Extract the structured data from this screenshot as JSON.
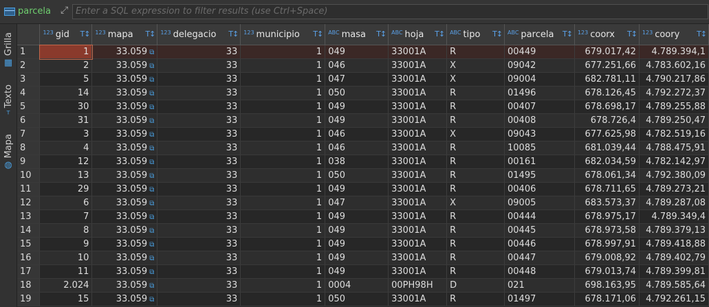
{
  "toolbar": {
    "table_name": "parcela",
    "filter_placeholder": "Enter a SQL expression to filter results (use Ctrl+Space)"
  },
  "side_tabs": [
    {
      "label": "Grilla",
      "icon": "grid-icon"
    },
    {
      "label": "Texto",
      "icon": "text-icon"
    },
    {
      "label": "Mapa",
      "icon": "globe-icon"
    }
  ],
  "columns": [
    {
      "name": "gid",
      "type": "123"
    },
    {
      "name": "mapa",
      "type": "123"
    },
    {
      "name": "delegacio",
      "type": "123"
    },
    {
      "name": "municipio",
      "type": "123"
    },
    {
      "name": "masa",
      "type": "ABC"
    },
    {
      "name": "hoja",
      "type": "ABC"
    },
    {
      "name": "tipo",
      "type": "ABC"
    },
    {
      "name": "parcela",
      "type": "ABC"
    },
    {
      "name": "coorx",
      "type": "123"
    },
    {
      "name": "coory",
      "type": "123"
    }
  ],
  "rows": [
    [
      "1",
      "1",
      "33.059",
      "33",
      "1",
      "049",
      "33001A",
      "R",
      "00449",
      "679.017,42",
      "4.789.394,1"
    ],
    [
      "2",
      "2",
      "33.059",
      "33",
      "1",
      "046",
      "33001A",
      "X",
      "09042",
      "677.251,66",
      "4.783.602,16"
    ],
    [
      "3",
      "5",
      "33.059",
      "33",
      "1",
      "047",
      "33001A",
      "X",
      "09004",
      "682.781,11",
      "4.790.217,86"
    ],
    [
      "4",
      "14",
      "33.059",
      "33",
      "1",
      "050",
      "33001A",
      "R",
      "01496",
      "678.126,45",
      "4.792.272,37"
    ],
    [
      "5",
      "30",
      "33.059",
      "33",
      "1",
      "049",
      "33001A",
      "R",
      "00407",
      "678.698,17",
      "4.789.255,88"
    ],
    [
      "6",
      "31",
      "33.059",
      "33",
      "1",
      "049",
      "33001A",
      "R",
      "00408",
      "678.726,4",
      "4.789.250,47"
    ],
    [
      "7",
      "3",
      "33.059",
      "33",
      "1",
      "046",
      "33001A",
      "X",
      "09043",
      "677.625,98",
      "4.782.519,16"
    ],
    [
      "8",
      "4",
      "33.059",
      "33",
      "1",
      "046",
      "33001A",
      "R",
      "10085",
      "681.039,44",
      "4.788.475,91"
    ],
    [
      "9",
      "12",
      "33.059",
      "33",
      "1",
      "038",
      "33001A",
      "R",
      "00161",
      "682.034,59",
      "4.782.142,97"
    ],
    [
      "10",
      "13",
      "33.059",
      "33",
      "1",
      "050",
      "33001A",
      "R",
      "01495",
      "678.061,34",
      "4.792.380,09"
    ],
    [
      "11",
      "29",
      "33.059",
      "33",
      "1",
      "049",
      "33001A",
      "R",
      "00406",
      "678.711,65",
      "4.789.273,21"
    ],
    [
      "12",
      "6",
      "33.059",
      "33",
      "1",
      "047",
      "33001A",
      "X",
      "09005",
      "683.573,37",
      "4.789.287,08"
    ],
    [
      "13",
      "7",
      "33.059",
      "33",
      "1",
      "049",
      "33001A",
      "R",
      "00444",
      "678.975,17",
      "4.789.349,4"
    ],
    [
      "14",
      "8",
      "33.059",
      "33",
      "1",
      "049",
      "33001A",
      "R",
      "00445",
      "678.973,58",
      "4.789.379,13"
    ],
    [
      "15",
      "9",
      "33.059",
      "33",
      "1",
      "049",
      "33001A",
      "R",
      "00446",
      "678.997,91",
      "4.789.418,88"
    ],
    [
      "16",
      "10",
      "33.059",
      "33",
      "1",
      "049",
      "33001A",
      "R",
      "00447",
      "679.008,92",
      "4.789.402,79"
    ],
    [
      "17",
      "11",
      "33.059",
      "33",
      "1",
      "049",
      "33001A",
      "R",
      "00448",
      "679.013,74",
      "4.789.399,81"
    ],
    [
      "18",
      "2.024",
      "33.059",
      "33",
      "1",
      "0004",
      "00PH98H",
      "D",
      "021",
      "698.163,95",
      "4.789.585,64"
    ],
    [
      "19",
      "15",
      "33.059",
      "33",
      "1",
      "050",
      "33001A",
      "R",
      "01497",
      "678.171,06",
      "4.792.261,15"
    ]
  ]
}
